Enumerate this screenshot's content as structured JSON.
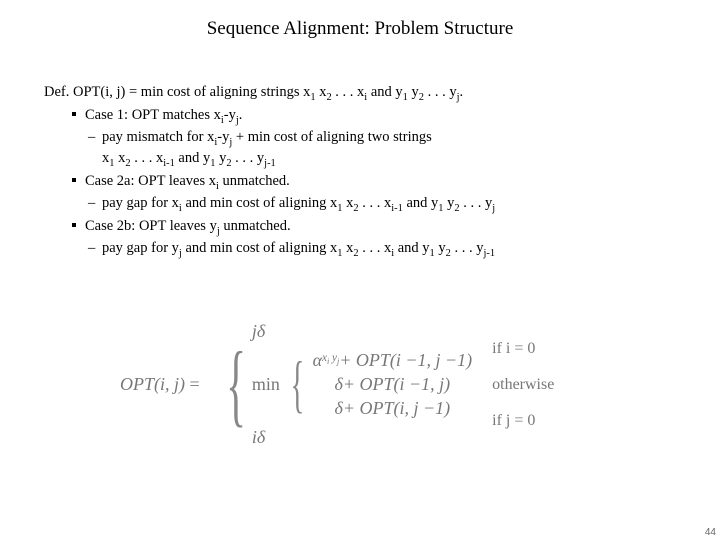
{
  "title": "Sequence Alignment:  Problem Structure",
  "def": {
    "label": "Def.",
    "text": "OPT(i, j) = min cost of aligning strings x",
    "text2": " x",
    "text3": " . . . x",
    "text4": " and y",
    "text5": " y",
    "text6": " . . . y",
    "dot": "."
  },
  "c1": {
    "head": "Case 1:  OPT matches x",
    "head2": "-y",
    "dot": ".",
    "line": "pay mismatch for x",
    "line2": "-y",
    "line3": "  + min cost of aligning two strings",
    "cont1": "x",
    "cont2": " x",
    "cont3": " . . . x",
    "cont4": " and y",
    "cont5": " y",
    "cont6": " . . . y"
  },
  "c2a": {
    "head": "Case 2a:  OPT leaves x",
    "head2": " unmatched.",
    "line": "pay gap for x",
    "line2": " and min cost of aligning x",
    "line3": " x",
    "line4": " . . . x",
    "line5": " and y",
    "line6": " y",
    "line7": " . . . y"
  },
  "c2b": {
    "head": "Case 2b:  OPT leaves y",
    "head2": " unmatched.",
    "line": "pay gap for y",
    "line2": " and min cost of aligning x",
    "line3": " x",
    "line4": " . . . x",
    "line5": " and y",
    "line6": " y",
    "line7": " . . . y"
  },
  "sub": {
    "one": "1",
    "two": "2",
    "i": "i",
    "j": "j",
    "im1": "i-1",
    "jm1": "j-1"
  },
  "fig": {
    "lhs": "OPT(i, j)",
    "eq": "=",
    "min": "min",
    "row0a": "j",
    "row0b": "δ",
    "row1a": "α",
    "row1sub": "x",
    "row1sub2": "i",
    "row1sub3": " y",
    "row1sub4": "j",
    "row1b": " + OPT(i −1, j −1)",
    "row2a": "δ",
    "row2b": " + OPT(i −1, j)",
    "row3a": "δ",
    "row3b": " + OPT(i, j −1)",
    "row4a": "i",
    "row4b": "δ",
    "cond1": "if i = 0",
    "cond2": "otherwise",
    "cond3": "if j = 0"
  },
  "page": "44"
}
